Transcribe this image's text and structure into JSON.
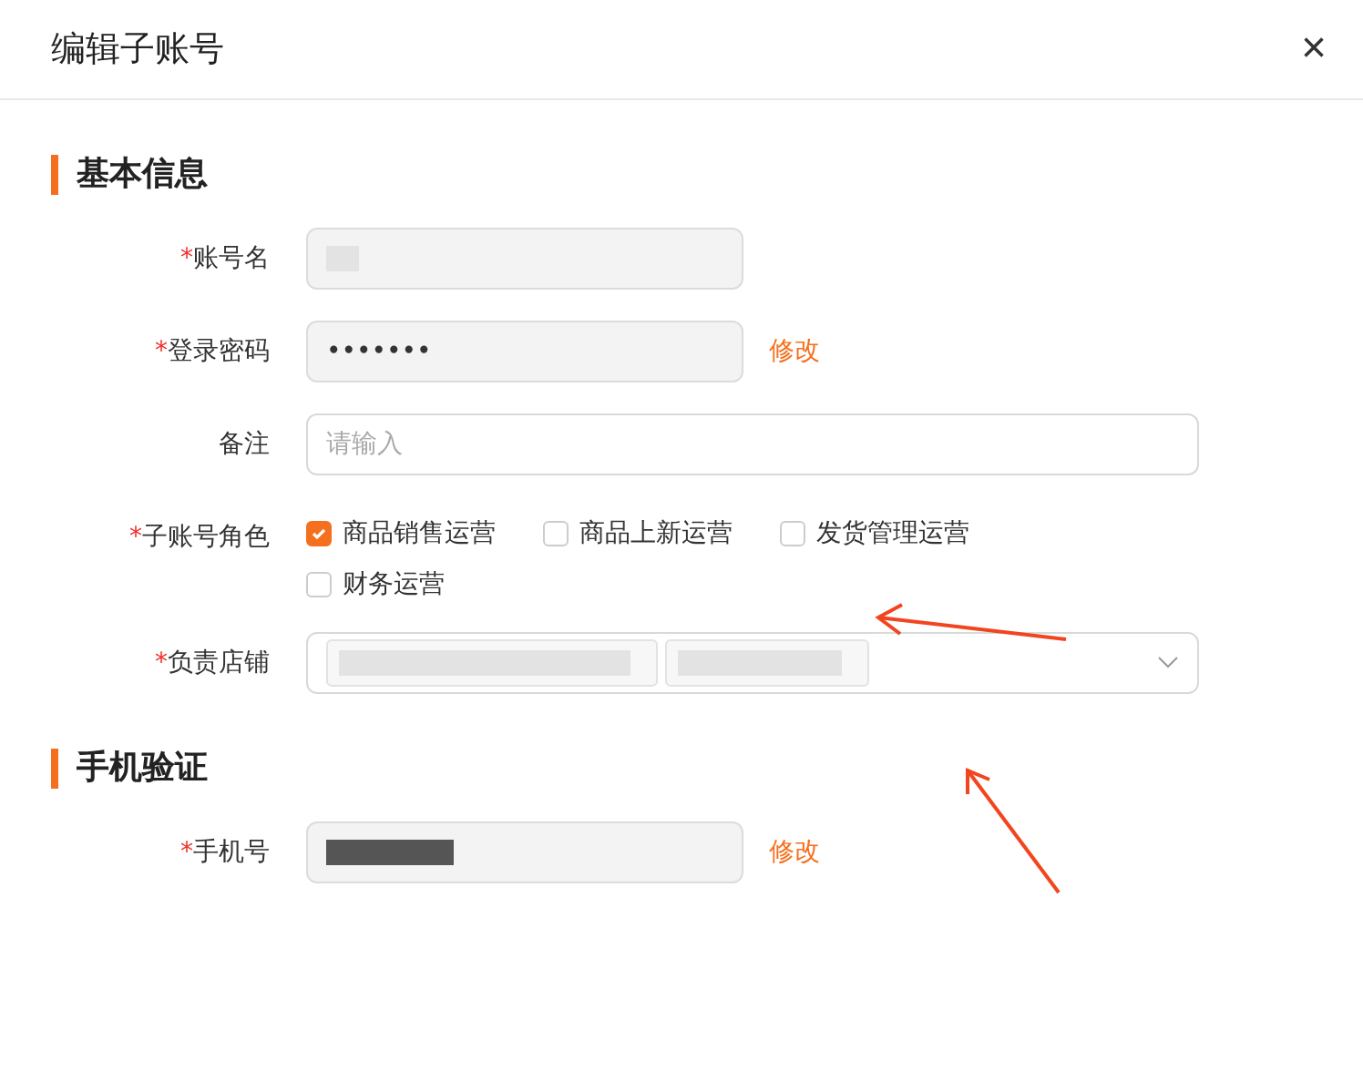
{
  "dialog": {
    "title": "编辑子账号",
    "close": "×"
  },
  "sections": [
    {
      "title": "基本信息",
      "fields": [
        {
          "kind": "readonly",
          "label": "账号名",
          "required_mark": "*",
          "redacted": true
        },
        {
          "kind": "password",
          "label": "登录密码",
          "required_mark": "*",
          "value": "•••••••",
          "action": "修改"
        },
        {
          "kind": "text",
          "label": "备注",
          "placeholder": "请输入"
        },
        {
          "kind": "checkboxes",
          "label": "子账号角色",
          "required_mark": "*",
          "options": [
            {
              "label": "商品销售运营",
              "checked": true
            },
            {
              "label": "商品上新运营",
              "checked": false
            },
            {
              "label": "发货管理运营",
              "checked": false
            },
            {
              "label": "财务运营",
              "checked": false
            }
          ]
        },
        {
          "kind": "select",
          "label": "负责店铺",
          "required_mark": "*",
          "tags": [
            {
              "redacted": true
            },
            {
              "redacted": true
            }
          ]
        }
      ]
    },
    {
      "title": "手机验证",
      "fields": [
        {
          "kind": "readonly",
          "label": "手机号",
          "required_mark": "*",
          "redacted": true,
          "action": "修改"
        }
      ]
    }
  ],
  "annotations": [
    {
      "kind": "arrow-left"
    },
    {
      "kind": "arrow-up"
    }
  ]
}
